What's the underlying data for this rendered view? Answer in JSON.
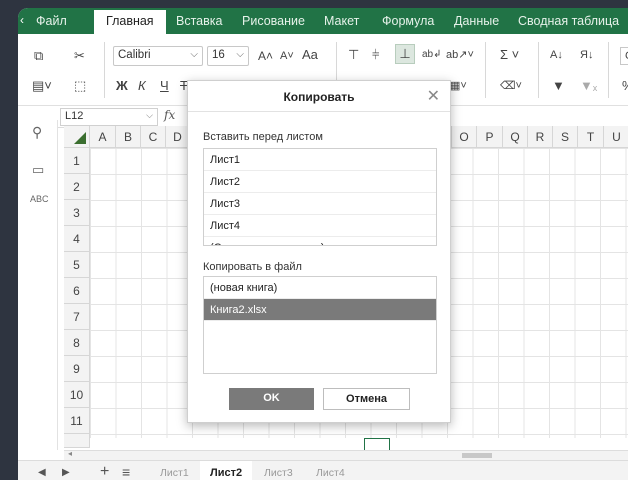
{
  "tabs": [
    "Файл",
    "Главная",
    "Вставка",
    "Рисование",
    "Макет",
    "Формула",
    "Данные",
    "Сводная таблица"
  ],
  "active_tab": "Главная",
  "ribbon": {
    "font_name": "Calibri",
    "font_size": "16",
    "grow_font": "A˄",
    "shrink_font": "A˅",
    "change_case": "Aa",
    "bold": "Ж",
    "italic": "К",
    "underline": "Ч",
    "strike": "Т",
    "sum": "Σ",
    "sort_asc": "А↓",
    "sort_desc": "Я↓",
    "cond": "С",
    "percent": "%"
  },
  "formula_bar": {
    "cell_ref": "L12",
    "fx": "fx"
  },
  "columns": [
    "A",
    "B",
    "C",
    "D",
    "O",
    "P",
    "Q",
    "R",
    "S",
    "T",
    "U"
  ],
  "rows": [
    "1",
    "2",
    "3",
    "4",
    "5",
    "6",
    "7",
    "8",
    "9",
    "10",
    "11"
  ],
  "sheets": [
    "Лист1",
    "Лист2",
    "Лист3",
    "Лист4"
  ],
  "active_sheet": "Лист2",
  "sheetbar": {
    "add": "+",
    "menu": "≡"
  },
  "dialog": {
    "title": "Копировать",
    "insert_before_label": "Вставить перед листом",
    "insert_before_items": [
      "Лист1",
      "Лист2",
      "Лист3",
      "Лист4",
      "(Скопировать в конец)"
    ],
    "copy_to_file_label": "Копировать в файл",
    "file_items": [
      "(новая книга)",
      "Книга2.xlsx"
    ],
    "selected_file": "Книга2.xlsx",
    "ok_label": "OK",
    "cancel_label": "Отмена"
  },
  "colors": {
    "accent": "#217346",
    "selected_item": "#7a7a7a"
  }
}
